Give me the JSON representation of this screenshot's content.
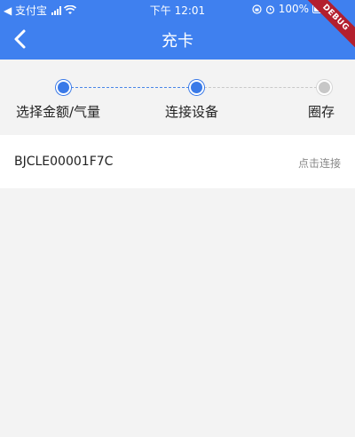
{
  "status_bar": {
    "carrier": "◀ 支付宝",
    "time": "下午 12:01",
    "battery": "100%"
  },
  "debug_banner": "DEBUG",
  "app_bar": {
    "title": "充卡",
    "back_icon": "chevron-left-icon"
  },
  "stepper": {
    "steps": [
      {
        "label": "选择金额/气量",
        "state": "done"
      },
      {
        "label": "连接设备",
        "state": "current"
      },
      {
        "label": "圈存",
        "state": "pending"
      }
    ]
  },
  "devices": [
    {
      "name": "BJCLE00001F7C",
      "action": "点击连接"
    }
  ],
  "colors": {
    "primary": "#3f80ef",
    "step_active": "#3a7ae8",
    "step_inactive": "#c7c7c7",
    "background": "#f3f3f3",
    "debug": "#b31f2e"
  }
}
